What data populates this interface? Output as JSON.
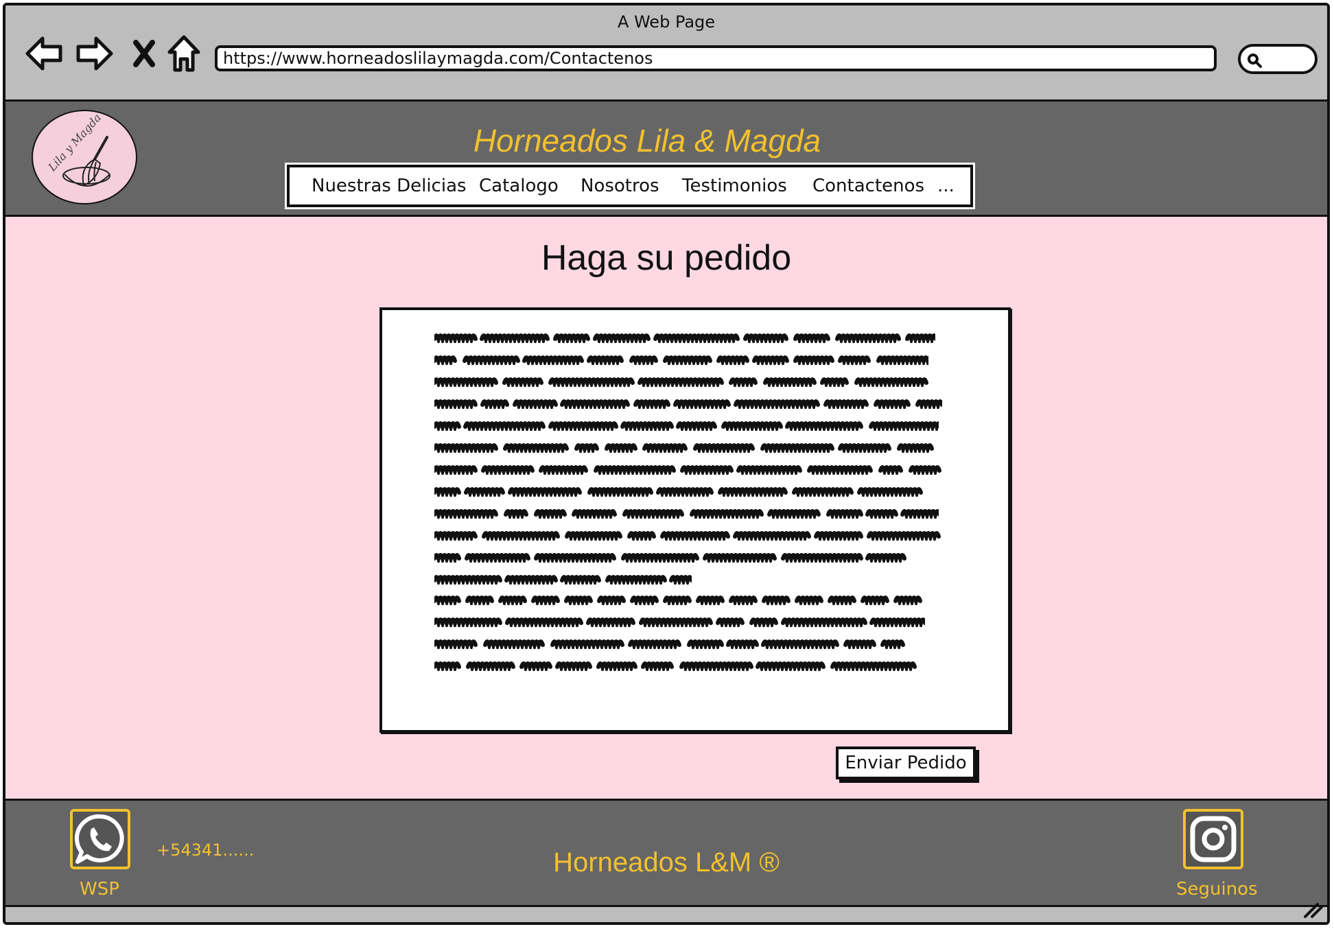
{
  "browser": {
    "window_title": "A Web Page",
    "url": "https://www.horneadoslilaymagda.com/Contactenos"
  },
  "header": {
    "logo_text": "Lila y Magda",
    "site_title": "Horneados Lila & Magda",
    "menu": [
      {
        "label": "Nuestras Delicias"
      },
      {
        "label": "Catalogo"
      },
      {
        "label": "Nosotros"
      },
      {
        "label": "Testimonios"
      },
      {
        "label": "Contactenos"
      },
      {
        "label": "..."
      }
    ]
  },
  "main": {
    "title": "Haga su pedido",
    "send_button": "Enviar Pedido"
  },
  "footer": {
    "whatsapp_label": "WSP",
    "phone": "+54341......",
    "brand": "Horneados L&M ®",
    "instagram_label": "Seguinos"
  },
  "colors": {
    "accent_yellow": "#f2c12e",
    "header_gray": "#666666",
    "chrome_gray": "#bdbdbd",
    "main_pink": "#fdd8e3",
    "logo_pink": "#f6cfdc"
  },
  "icons": [
    "back-arrow-icon",
    "forward-arrow-icon",
    "close-icon",
    "home-icon",
    "search-icon",
    "whisk-icon",
    "whatsapp-icon",
    "instagram-icon",
    "resize-grip-icon"
  ]
}
